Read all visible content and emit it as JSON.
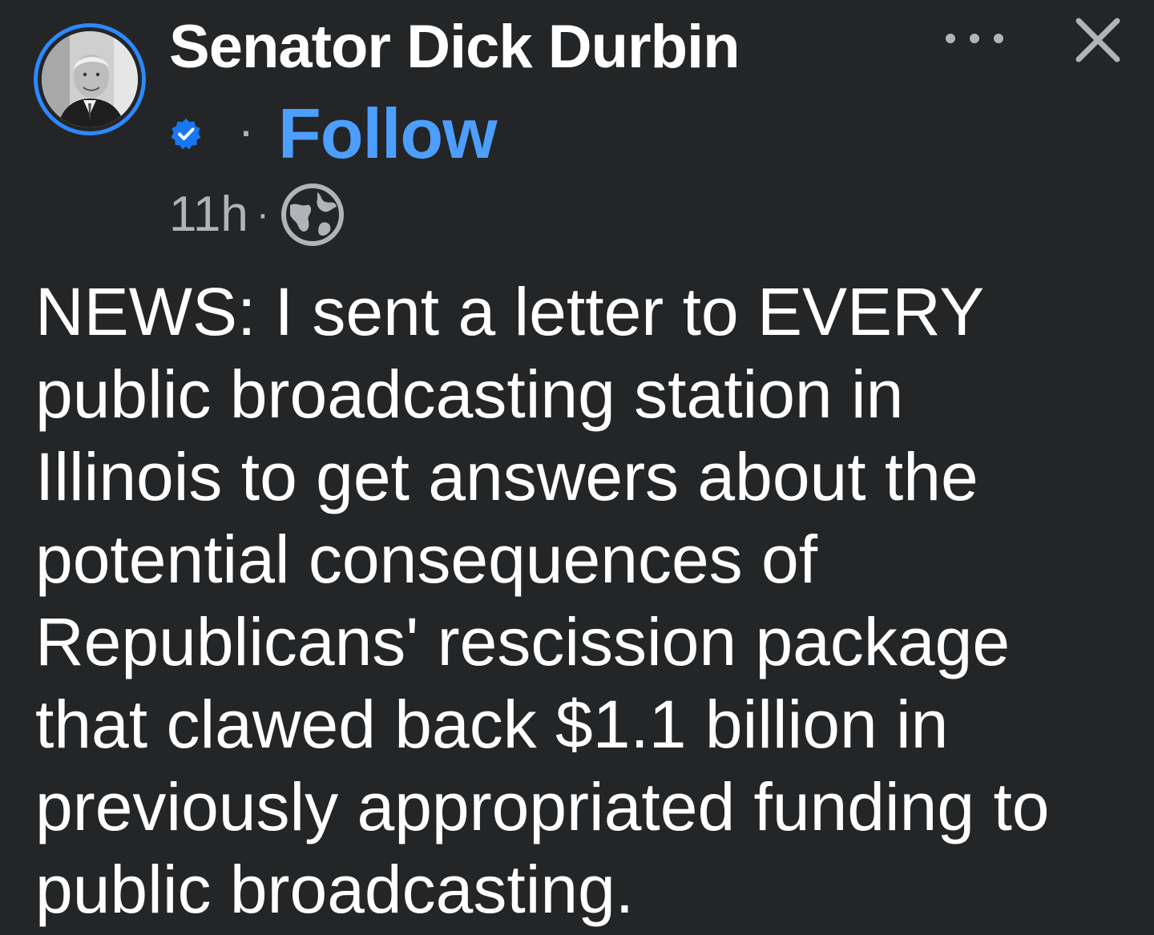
{
  "post": {
    "author_name": "Senator Dick Durbin",
    "follow_label": "Follow",
    "separator": "·",
    "timestamp": "11h",
    "time_separator": "·",
    "privacy_icon": "globe-icon",
    "verified_icon": "verified-badge-icon",
    "more_icon": "more-options-icon",
    "close_icon": "close-icon",
    "body_text": "NEWS: I sent a letter to EVERY\npublic broadcasting station in\nIllinois to get answers about the\npotential consequences of\nRepublicans' rescission package\nthat clawed back $1.1 billion in\npreviously appropriated funding to\npublic broadcasting."
  },
  "colors": {
    "background": "#242526",
    "text_primary": "#ffffff",
    "text_secondary": "#b0b3b8",
    "accent_blue": "#4c9eff",
    "avatar_ring": "#2d88ff"
  }
}
